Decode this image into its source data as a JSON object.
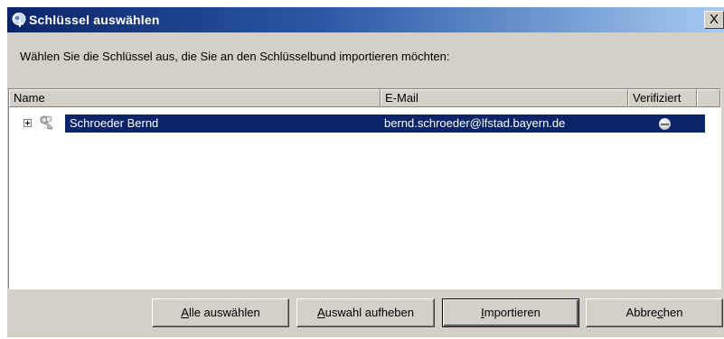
{
  "window": {
    "title": "Schlüssel auswählen",
    "close_label": "X"
  },
  "instruction": "Wählen Sie die Schlüssel aus, die Sie an den Schlüsselbund importieren möchten:",
  "table": {
    "columns": [
      "Name",
      "E-Mail",
      "Verifiziert"
    ],
    "rows": [
      {
        "name": "Schroeder Bernd",
        "email": "bernd.schroeder@lfstad.bayern.de",
        "verified_icon": "verified-status-icon",
        "selected": true
      }
    ]
  },
  "buttons": {
    "select_all": {
      "pre": "",
      "accel": "A",
      "post": "lle auswählen"
    },
    "deselect": {
      "pre": "",
      "accel": "A",
      "post": "uswahl aufheben"
    },
    "import": {
      "pre": "",
      "accel": "I",
      "post": "mportieren"
    },
    "cancel": {
      "pre": "Abbre",
      "accel": "c",
      "post": "hen"
    }
  },
  "colors": {
    "selection": "#0a246a",
    "titlebar_start": "#0a246a",
    "titlebar_end": "#a6caf0",
    "dialog_bg": "#d4d0c8"
  },
  "icons": {
    "app": "gpg-key-app-icon",
    "row": "key-pair-icon",
    "expand": "plus-expander-icon"
  }
}
